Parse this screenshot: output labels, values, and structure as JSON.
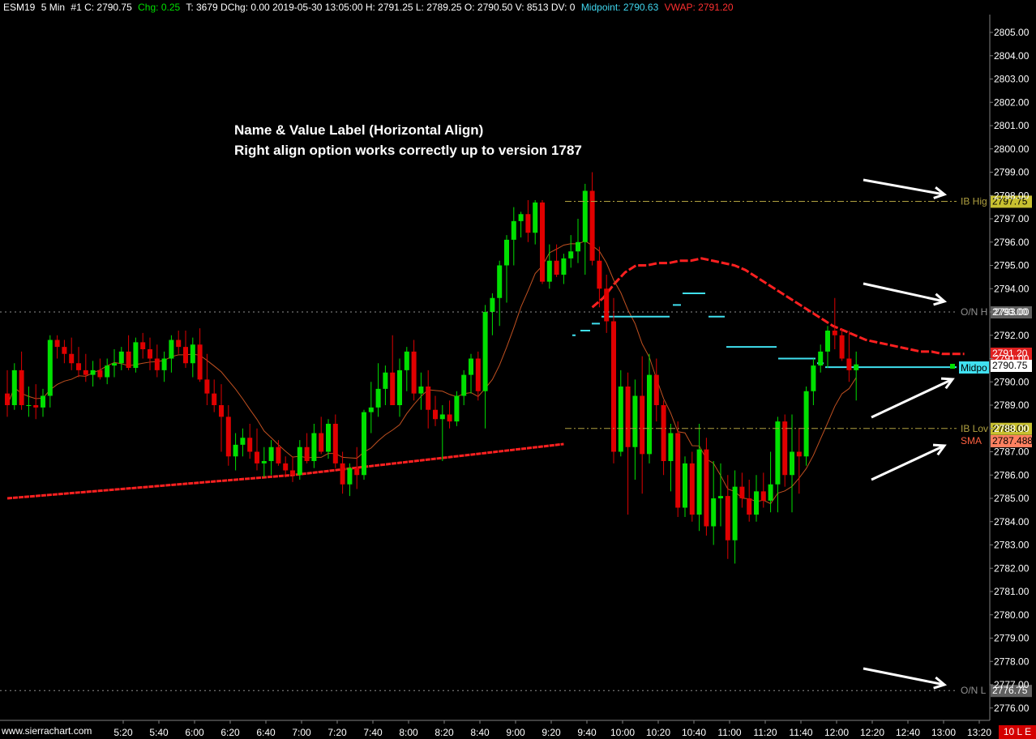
{
  "header": {
    "symbol": "ESM19",
    "timeframe": "5 Min",
    "bar_info": "#1 C: 2790.75",
    "chg_label": "Chg:",
    "chg_value": "0.25",
    "rest": "T: 3679 DChg: 0.00 2019-05-30 13:05:00 H: 2791.25 L: 2789.25 O: 2790.50 V: 8513 DV: 0",
    "midpoint_label": "Midpoint:",
    "midpoint_value": "2790.63",
    "vwap_label": "VWAP:",
    "vwap_value": "2791.20"
  },
  "annotation": {
    "line1": "Name & Value Label (Horizontal Align)",
    "line2": "Right align option works correctly up to version 1787"
  },
  "footer": {
    "site": "www.sierrachart.com",
    "mode": "10 L E"
  },
  "colors": {
    "up_candle": "#00e000",
    "down_candle": "#e00000",
    "vwap": "#ff2020",
    "midpoint": "#40e0f0",
    "sma": "#c05020",
    "ib_lines": "#b0a040",
    "on_lines": "#909090"
  },
  "chart_data": {
    "type": "candlestick",
    "ylim": [
      2775.5,
      2806.0
    ],
    "y_ticks": [
      "2805.00",
      "2804.00",
      "2803.00",
      "2802.00",
      "2801.00",
      "2800.00",
      "2799.00",
      "2798.00",
      "2797.00",
      "2796.00",
      "2795.00",
      "2794.00",
      "2793.00",
      "2792.00",
      "2791.00",
      "2790.00",
      "2789.00",
      "2788.00",
      "2787.00",
      "2786.00",
      "2785.00",
      "2784.00",
      "2783.00",
      "2782.00",
      "2781.00",
      "2780.00",
      "2779.00",
      "2778.00",
      "2777.00",
      "2776.00"
    ],
    "x_ticks": [
      "5:20",
      "5:40",
      "6:00",
      "6:20",
      "6:40",
      "7:00",
      "7:20",
      "7:40",
      "8:00",
      "8:20",
      "8:40",
      "9:00",
      "9:20",
      "9:40",
      "10:00",
      "10:20",
      "10:40",
      "11:00",
      "11:20",
      "11:40",
      "12:00",
      "12:20",
      "12:40",
      "13:00",
      "13:20"
    ],
    "levels": [
      {
        "name": "IB High",
        "label": "IB Hig",
        "value": "2797.75",
        "price": 2797.75
      },
      {
        "name": "O/N High",
        "label": "O/N H",
        "value": "2793.00",
        "price": 2793.0
      },
      {
        "name": "IB Low",
        "label": "IB Lov",
        "value": "2788.00",
        "price": 2788.0
      },
      {
        "name": "O/N Low",
        "label": "O/N L",
        "value": "2776.75",
        "price": 2776.75
      }
    ],
    "price_labels": [
      {
        "name": "VWAP",
        "value": "2791.20",
        "price": 2791.2
      },
      {
        "name": "Last",
        "value": "2790.75",
        "price": 2790.75
      },
      {
        "name": "SMA",
        "label": "SMA",
        "value": "2787.488",
        "price": 2787.488
      },
      {
        "name": "Midpoint",
        "label": "Midpo",
        "value": "2790.63",
        "price": 2790.63
      }
    ],
    "candles_first_time": "5:00",
    "candles": [
      [
        2789.5,
        2790.5,
        2788.5,
        2789.0
      ],
      [
        2789.0,
        2790.8,
        2788.8,
        2790.5
      ],
      [
        2790.5,
        2791.3,
        2788.8,
        2789.0
      ],
      [
        2789.0,
        2789.8,
        2788.5,
        2789.0
      ],
      [
        2789.0,
        2789.9,
        2788.4,
        2788.9
      ],
      [
        2788.9,
        2789.7,
        2788.5,
        2789.4
      ],
      [
        2789.4,
        2792.0,
        2788.9,
        2791.8
      ],
      [
        2791.8,
        2792.0,
        2791.0,
        2791.5
      ],
      [
        2791.5,
        2791.8,
        2790.8,
        2791.2
      ],
      [
        2791.2,
        2791.9,
        2790.5,
        2790.8
      ],
      [
        2790.8,
        2791.5,
        2790.2,
        2790.5
      ],
      [
        2790.5,
        2791.2,
        2790.0,
        2790.3
      ],
      [
        2790.3,
        2790.9,
        2789.8,
        2790.5
      ],
      [
        2790.5,
        2791.0,
        2790.1,
        2790.2
      ],
      [
        2790.2,
        2791.0,
        2789.9,
        2790.7
      ],
      [
        2790.7,
        2791.4,
        2790.2,
        2790.8
      ],
      [
        2790.8,
        2791.5,
        2790.5,
        2791.3
      ],
      [
        2791.3,
        2792.0,
        2790.5,
        2790.6
      ],
      [
        2790.6,
        2791.9,
        2790.4,
        2791.7
      ],
      [
        2791.7,
        2792.1,
        2791.0,
        2791.4
      ],
      [
        2791.4,
        2791.9,
        2790.5,
        2791.0
      ],
      [
        2791.0,
        2791.6,
        2790.2,
        2790.5
      ],
      [
        2790.5,
        2791.3,
        2790.0,
        2791.0
      ],
      [
        2791.0,
        2792.0,
        2790.4,
        2791.8
      ],
      [
        2791.8,
        2792.2,
        2791.2,
        2791.5
      ],
      [
        2791.5,
        2792.2,
        2790.6,
        2790.8
      ],
      [
        2790.8,
        2791.9,
        2790.2,
        2791.6
      ],
      [
        2791.6,
        2792.3,
        2790.0,
        2790.1
      ],
      [
        2790.1,
        2791.2,
        2789.0,
        2789.5
      ],
      [
        2789.5,
        2790.1,
        2788.7,
        2789.0
      ],
      [
        2789.0,
        2789.9,
        2787.0,
        2788.5
      ],
      [
        2788.5,
        2789.0,
        2786.4,
        2786.8
      ],
      [
        2786.8,
        2787.8,
        2786.2,
        2787.3
      ],
      [
        2787.3,
        2788.0,
        2786.8,
        2787.6
      ],
      [
        2787.6,
        2788.2,
        2786.7,
        2787.0
      ],
      [
        2787.0,
        2788.0,
        2786.2,
        2786.5
      ],
      [
        2786.5,
        2787.2,
        2785.9,
        2786.6
      ],
      [
        2786.6,
        2787.5,
        2786.0,
        2787.2
      ],
      [
        2787.2,
        2787.5,
        2786.4,
        2786.5
      ],
      [
        2786.5,
        2786.8,
        2785.9,
        2786.2
      ],
      [
        2786.2,
        2786.8,
        2785.7,
        2786.0
      ],
      [
        2786.0,
        2787.5,
        2785.8,
        2787.2
      ],
      [
        2787.2,
        2787.8,
        2786.5,
        2786.6
      ],
      [
        2786.6,
        2788.2,
        2786.3,
        2787.8
      ],
      [
        2787.8,
        2788.5,
        2786.9,
        2787.0
      ],
      [
        2787.0,
        2788.4,
        2786.7,
        2788.2
      ],
      [
        2788.2,
        2788.6,
        2786.3,
        2786.5
      ],
      [
        2786.5,
        2787.0,
        2785.2,
        2785.6
      ],
      [
        2785.6,
        2786.5,
        2785.1,
        2786.3
      ],
      [
        2786.3,
        2787.2,
        2785.4,
        2786.0
      ],
      [
        2786.0,
        2788.8,
        2785.8,
        2788.7
      ],
      [
        2788.7,
        2790.0,
        2787.8,
        2788.9
      ],
      [
        2788.9,
        2790.8,
        2788.5,
        2789.7
      ],
      [
        2789.7,
        2790.7,
        2789.0,
        2790.4
      ],
      [
        2790.4,
        2792.0,
        2789.5,
        2789.0
      ],
      [
        2789.0,
        2791.0,
        2788.5,
        2790.5
      ],
      [
        2790.5,
        2791.5,
        2789.6,
        2791.3
      ],
      [
        2791.3,
        2791.8,
        2789.2,
        2789.5
      ],
      [
        2789.5,
        2790.4,
        2788.8,
        2789.8
      ],
      [
        2789.8,
        2790.5,
        2788.0,
        2788.8
      ],
      [
        2788.8,
        2789.4,
        2788.1,
        2788.4
      ],
      [
        2788.4,
        2789.0,
        2786.6,
        2788.6
      ],
      [
        2788.6,
        2789.2,
        2788.0,
        2788.3
      ],
      [
        2788.3,
        2789.6,
        2788.1,
        2789.4
      ],
      [
        2789.4,
        2790.5,
        2789.0,
        2790.3
      ],
      [
        2790.3,
        2791.2,
        2789.5,
        2791.0
      ],
      [
        2791.0,
        2791.3,
        2789.2,
        2789.6
      ],
      [
        2789.6,
        2793.3,
        2788.0,
        2793.0
      ],
      [
        2793.0,
        2793.8,
        2792.0,
        2793.6
      ],
      [
        2793.6,
        2795.2,
        2792.4,
        2795.0
      ],
      [
        2795.0,
        2796.3,
        2793.4,
        2796.1
      ],
      [
        2796.1,
        2797.5,
        2795.0,
        2796.9
      ],
      [
        2796.9,
        2797.3,
        2796.2,
        2797.2
      ],
      [
        2797.2,
        2797.8,
        2796.0,
        2796.4
      ],
      [
        2796.4,
        2797.8,
        2795.9,
        2797.7
      ],
      [
        2797.7,
        2797.8,
        2794.2,
        2794.3
      ],
      [
        2794.3,
        2795.9,
        2794.0,
        2795.2
      ],
      [
        2795.2,
        2795.9,
        2794.5,
        2794.6
      ],
      [
        2794.6,
        2795.5,
        2794.2,
        2795.3
      ],
      [
        2795.3,
        2796.3,
        2794.9,
        2795.6
      ],
      [
        2795.6,
        2797.0,
        2795.1,
        2796.0
      ],
      [
        2796.0,
        2798.5,
        2794.6,
        2798.2
      ],
      [
        2798.2,
        2799.0,
        2795.0,
        2795.2
      ],
      [
        2795.2,
        2795.8,
        2793.2,
        2794.0
      ],
      [
        2794.0,
        2794.6,
        2792.1,
        2792.6
      ],
      [
        2792.6,
        2793.6,
        2786.5,
        2787.0
      ],
      [
        2787.0,
        2790.5,
        2786.8,
        2789.8
      ],
      [
        2789.8,
        2790.4,
        2784.3,
        2787.2
      ],
      [
        2787.2,
        2790.1,
        2785.8,
        2789.4
      ],
      [
        2789.4,
        2791.1,
        2785.2,
        2786.9
      ],
      [
        2786.9,
        2791.2,
        2786.5,
        2790.3
      ],
      [
        2790.3,
        2791.0,
        2788.3,
        2789.0
      ],
      [
        2789.0,
        2789.2,
        2786.0,
        2786.6
      ],
      [
        2786.6,
        2788.2,
        2785.3,
        2787.8
      ],
      [
        2787.8,
        2788.3,
        2784.2,
        2784.6
      ],
      [
        2784.6,
        2786.8,
        2784.2,
        2786.5
      ],
      [
        2786.5,
        2787.0,
        2784.0,
        2784.3
      ],
      [
        2784.3,
        2788.2,
        2783.6,
        2787.1
      ],
      [
        2787.1,
        2787.6,
        2783.4,
        2783.8
      ],
      [
        2783.8,
        2786.6,
        2783.0,
        2785.0
      ],
      [
        2785.0,
        2786.5,
        2783.8,
        2785.1
      ],
      [
        2785.1,
        2786.0,
        2782.4,
        2783.2
      ],
      [
        2783.2,
        2786.2,
        2782.2,
        2785.5
      ],
      [
        2785.5,
        2786.1,
        2784.6,
        2785.0
      ],
      [
        2785.0,
        2785.8,
        2784.0,
        2784.3
      ],
      [
        2784.3,
        2786.0,
        2784.0,
        2785.3
      ],
      [
        2785.3,
        2786.1,
        2784.6,
        2784.9
      ],
      [
        2784.9,
        2787.0,
        2784.4,
        2785.6
      ],
      [
        2785.6,
        2788.5,
        2784.4,
        2788.3
      ],
      [
        2788.3,
        2788.6,
        2785.5,
        2786.0
      ],
      [
        2786.0,
        2788.6,
        2784.4,
        2787.0
      ],
      [
        2787.0,
        2788.0,
        2785.2,
        2786.8
      ],
      [
        2786.8,
        2789.8,
        2786.4,
        2789.6
      ],
      [
        2789.6,
        2791.0,
        2789.0,
        2790.7
      ],
      [
        2790.7,
        2791.6,
        2790.4,
        2791.3
      ],
      [
        2791.3,
        2792.4,
        2790.6,
        2792.2
      ],
      [
        2792.2,
        2793.6,
        2791.4,
        2792.0
      ],
      [
        2792.0,
        2792.3,
        2790.9,
        2791.0
      ],
      [
        2791.0,
        2792.2,
        2790.0,
        2790.5
      ],
      [
        2790.5,
        2791.3,
        2789.2,
        2790.75
      ]
    ]
  }
}
